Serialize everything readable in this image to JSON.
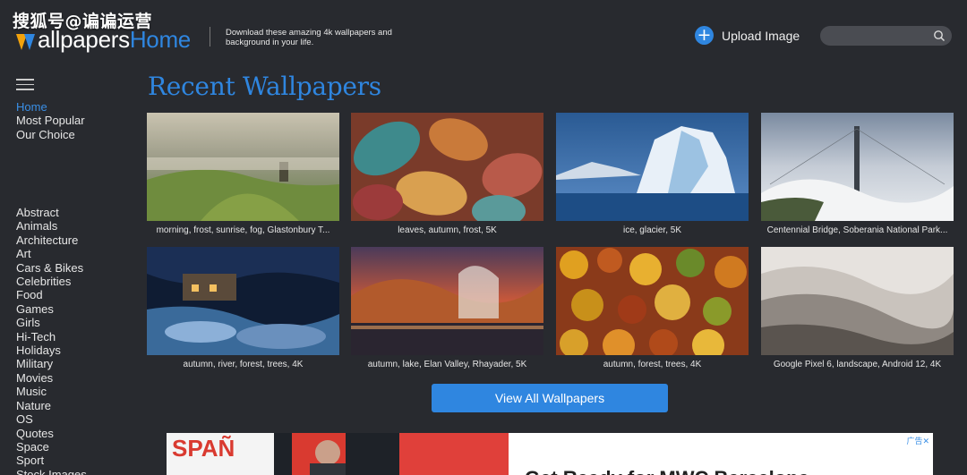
{
  "watermark": "搜狐号@谝谝运营",
  "header": {
    "logo_text_main": "allpapers",
    "logo_text_accent": "Home",
    "tagline": "Download these amazing 4k wallpapers and background in your life.",
    "upload_label": "Upload Image",
    "search_placeholder": ""
  },
  "sidebar": {
    "nav": [
      {
        "label": "Home"
      },
      {
        "label": "Most Popular"
      },
      {
        "label": "Our Choice"
      }
    ],
    "categories": [
      "Abstract",
      "Animals",
      "Architecture",
      "Art",
      "Cars & Bikes",
      "Celebrities",
      "Food",
      "Games",
      "Girls",
      "Hi-Tech",
      "Holidays",
      "Military",
      "Movies",
      "Music",
      "Nature",
      "OS",
      "Quotes",
      "Space",
      "Sport",
      "Stock Images"
    ]
  },
  "main": {
    "title": "Recent Wallpapers",
    "wallpapers": [
      {
        "caption": "morning, frost, sunrise, fog, Glastonbury T..."
      },
      {
        "caption": "leaves, autumn, frost, 5K"
      },
      {
        "caption": "ice, glacier, 5K"
      },
      {
        "caption": "Centennial Bridge, Soberania National Park..."
      },
      {
        "caption": "autumn, river, forest, trees, 4K"
      },
      {
        "caption": "autumn, lake, Elan Valley, Rhayader, 5K"
      },
      {
        "caption": "autumn, forest, trees, 4K"
      },
      {
        "caption": "Google Pixel 6, landscape, Android 12, 4K"
      }
    ],
    "view_all_label": "View All Wallpapers"
  },
  "ad": {
    "tag": "广告✕",
    "headline": "Get Ready for MWC Barcelona",
    "banner_text": "SPAÑ"
  },
  "colors": {
    "background": "#282a2f",
    "accent": "#2f86e0",
    "logo_orange": "#f2a20c"
  }
}
